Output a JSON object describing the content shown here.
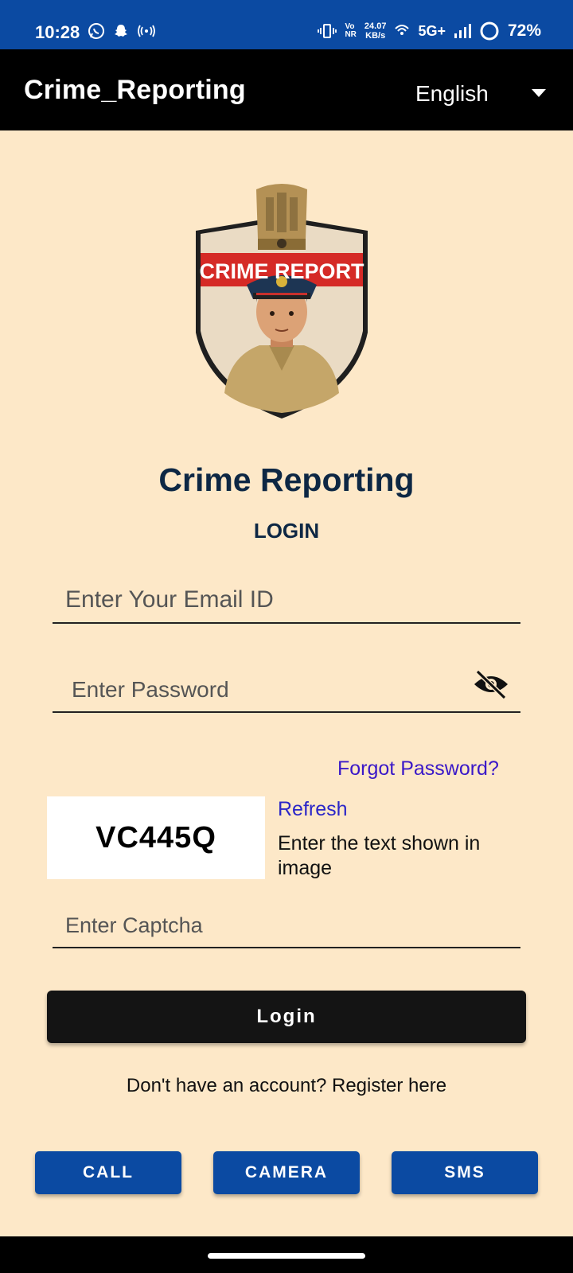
{
  "status_bar": {
    "time": "10:28",
    "vo_nr": "Vo\nNR",
    "net_speed": "24.07\nKB/s",
    "network": "5G+",
    "battery": "72%"
  },
  "app_bar": {
    "title": "Crime_Reporting",
    "language": "English"
  },
  "logo": {
    "banner_text": "CRIME REPORT"
  },
  "header": {
    "title": "Crime Reporting",
    "subtitle": "LOGIN"
  },
  "form": {
    "email_placeholder": "Enter Your Email ID",
    "password_placeholder": "Enter Password",
    "forgot_password": "Forgot Password?",
    "captcha_code": "VC445Q",
    "refresh": "Refresh",
    "captcha_hint": "Enter the text shown in image",
    "captcha_placeholder": "Enter Captcha",
    "login": "Login",
    "register": "Don't have an account? Register here"
  },
  "actions": {
    "call": "CALL",
    "camera": "CAMERA",
    "sms": "SMS"
  },
  "colors": {
    "status_bar": "#0b4aa2",
    "background": "#fde8c8",
    "heading": "#0d2744",
    "link": "#3a18c8",
    "action_button": "#0b4aa2"
  },
  "icons": [
    "whatsapp-icon",
    "snapchat-icon",
    "hotspot-icon",
    "vibrate-icon",
    "wifi-icon",
    "signal-icon",
    "battery-ring-icon",
    "dropdown-caret-icon",
    "eye-off-icon"
  ]
}
